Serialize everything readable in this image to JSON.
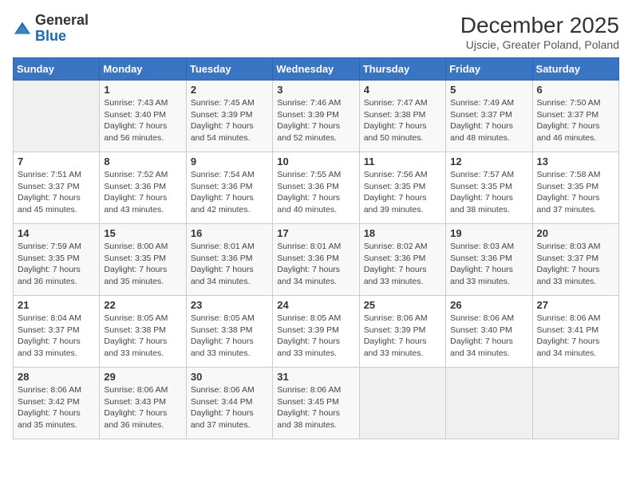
{
  "logo": {
    "general": "General",
    "blue": "Blue"
  },
  "header": {
    "month": "December 2025",
    "location": "Ujscie, Greater Poland, Poland"
  },
  "weekdays": [
    "Sunday",
    "Monday",
    "Tuesday",
    "Wednesday",
    "Thursday",
    "Friday",
    "Saturday"
  ],
  "weeks": [
    [
      {
        "day": "",
        "sunrise": "",
        "sunset": "",
        "daylight": ""
      },
      {
        "day": "1",
        "sunrise": "Sunrise: 7:43 AM",
        "sunset": "Sunset: 3:40 PM",
        "daylight": "Daylight: 7 hours and 56 minutes."
      },
      {
        "day": "2",
        "sunrise": "Sunrise: 7:45 AM",
        "sunset": "Sunset: 3:39 PM",
        "daylight": "Daylight: 7 hours and 54 minutes."
      },
      {
        "day": "3",
        "sunrise": "Sunrise: 7:46 AM",
        "sunset": "Sunset: 3:39 PM",
        "daylight": "Daylight: 7 hours and 52 minutes."
      },
      {
        "day": "4",
        "sunrise": "Sunrise: 7:47 AM",
        "sunset": "Sunset: 3:38 PM",
        "daylight": "Daylight: 7 hours and 50 minutes."
      },
      {
        "day": "5",
        "sunrise": "Sunrise: 7:49 AM",
        "sunset": "Sunset: 3:37 PM",
        "daylight": "Daylight: 7 hours and 48 minutes."
      },
      {
        "day": "6",
        "sunrise": "Sunrise: 7:50 AM",
        "sunset": "Sunset: 3:37 PM",
        "daylight": "Daylight: 7 hours and 46 minutes."
      }
    ],
    [
      {
        "day": "7",
        "sunrise": "Sunrise: 7:51 AM",
        "sunset": "Sunset: 3:37 PM",
        "daylight": "Daylight: 7 hours and 45 minutes."
      },
      {
        "day": "8",
        "sunrise": "Sunrise: 7:52 AM",
        "sunset": "Sunset: 3:36 PM",
        "daylight": "Daylight: 7 hours and 43 minutes."
      },
      {
        "day": "9",
        "sunrise": "Sunrise: 7:54 AM",
        "sunset": "Sunset: 3:36 PM",
        "daylight": "Daylight: 7 hours and 42 minutes."
      },
      {
        "day": "10",
        "sunrise": "Sunrise: 7:55 AM",
        "sunset": "Sunset: 3:36 PM",
        "daylight": "Daylight: 7 hours and 40 minutes."
      },
      {
        "day": "11",
        "sunrise": "Sunrise: 7:56 AM",
        "sunset": "Sunset: 3:35 PM",
        "daylight": "Daylight: 7 hours and 39 minutes."
      },
      {
        "day": "12",
        "sunrise": "Sunrise: 7:57 AM",
        "sunset": "Sunset: 3:35 PM",
        "daylight": "Daylight: 7 hours and 38 minutes."
      },
      {
        "day": "13",
        "sunrise": "Sunrise: 7:58 AM",
        "sunset": "Sunset: 3:35 PM",
        "daylight": "Daylight: 7 hours and 37 minutes."
      }
    ],
    [
      {
        "day": "14",
        "sunrise": "Sunrise: 7:59 AM",
        "sunset": "Sunset: 3:35 PM",
        "daylight": "Daylight: 7 hours and 36 minutes."
      },
      {
        "day": "15",
        "sunrise": "Sunrise: 8:00 AM",
        "sunset": "Sunset: 3:35 PM",
        "daylight": "Daylight: 7 hours and 35 minutes."
      },
      {
        "day": "16",
        "sunrise": "Sunrise: 8:01 AM",
        "sunset": "Sunset: 3:36 PM",
        "daylight": "Daylight: 7 hours and 34 minutes."
      },
      {
        "day": "17",
        "sunrise": "Sunrise: 8:01 AM",
        "sunset": "Sunset: 3:36 PM",
        "daylight": "Daylight: 7 hours and 34 minutes."
      },
      {
        "day": "18",
        "sunrise": "Sunrise: 8:02 AM",
        "sunset": "Sunset: 3:36 PM",
        "daylight": "Daylight: 7 hours and 33 minutes."
      },
      {
        "day": "19",
        "sunrise": "Sunrise: 8:03 AM",
        "sunset": "Sunset: 3:36 PM",
        "daylight": "Daylight: 7 hours and 33 minutes."
      },
      {
        "day": "20",
        "sunrise": "Sunrise: 8:03 AM",
        "sunset": "Sunset: 3:37 PM",
        "daylight": "Daylight: 7 hours and 33 minutes."
      }
    ],
    [
      {
        "day": "21",
        "sunrise": "Sunrise: 8:04 AM",
        "sunset": "Sunset: 3:37 PM",
        "daylight": "Daylight: 7 hours and 33 minutes."
      },
      {
        "day": "22",
        "sunrise": "Sunrise: 8:05 AM",
        "sunset": "Sunset: 3:38 PM",
        "daylight": "Daylight: 7 hours and 33 minutes."
      },
      {
        "day": "23",
        "sunrise": "Sunrise: 8:05 AM",
        "sunset": "Sunset: 3:38 PM",
        "daylight": "Daylight: 7 hours and 33 minutes."
      },
      {
        "day": "24",
        "sunrise": "Sunrise: 8:05 AM",
        "sunset": "Sunset: 3:39 PM",
        "daylight": "Daylight: 7 hours and 33 minutes."
      },
      {
        "day": "25",
        "sunrise": "Sunrise: 8:06 AM",
        "sunset": "Sunset: 3:39 PM",
        "daylight": "Daylight: 7 hours and 33 minutes."
      },
      {
        "day": "26",
        "sunrise": "Sunrise: 8:06 AM",
        "sunset": "Sunset: 3:40 PM",
        "daylight": "Daylight: 7 hours and 34 minutes."
      },
      {
        "day": "27",
        "sunrise": "Sunrise: 8:06 AM",
        "sunset": "Sunset: 3:41 PM",
        "daylight": "Daylight: 7 hours and 34 minutes."
      }
    ],
    [
      {
        "day": "28",
        "sunrise": "Sunrise: 8:06 AM",
        "sunset": "Sunset: 3:42 PM",
        "daylight": "Daylight: 7 hours and 35 minutes."
      },
      {
        "day": "29",
        "sunrise": "Sunrise: 8:06 AM",
        "sunset": "Sunset: 3:43 PM",
        "daylight": "Daylight: 7 hours and 36 minutes."
      },
      {
        "day": "30",
        "sunrise": "Sunrise: 8:06 AM",
        "sunset": "Sunset: 3:44 PM",
        "daylight": "Daylight: 7 hours and 37 minutes."
      },
      {
        "day": "31",
        "sunrise": "Sunrise: 8:06 AM",
        "sunset": "Sunset: 3:45 PM",
        "daylight": "Daylight: 7 hours and 38 minutes."
      },
      {
        "day": "",
        "sunrise": "",
        "sunset": "",
        "daylight": ""
      },
      {
        "day": "",
        "sunrise": "",
        "sunset": "",
        "daylight": ""
      },
      {
        "day": "",
        "sunrise": "",
        "sunset": "",
        "daylight": ""
      }
    ]
  ]
}
